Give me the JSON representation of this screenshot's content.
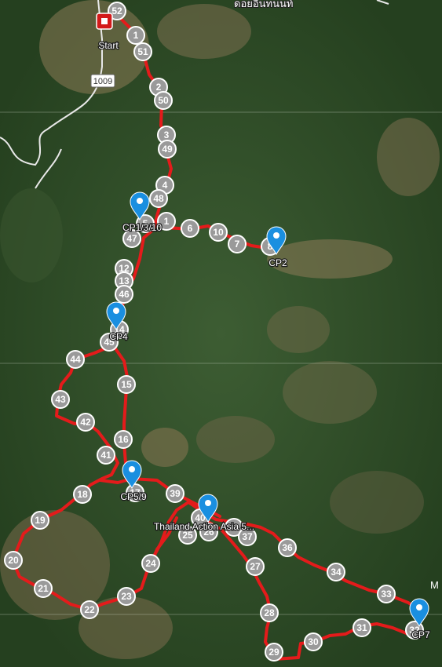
{
  "map": {
    "route_color": "#e41b1b",
    "checkpoint_color": "#1a8fe0",
    "km_marker_color": "#9a9a9a",
    "start_color": "#d31a1a",
    "start_label": "Start",
    "road_number": "1009",
    "place_name": "ดอยอินทนนท์",
    "edge_label": "M"
  },
  "checkpoints": [
    {
      "label": "CP1/3/10"
    },
    {
      "label": "CP2"
    },
    {
      "label": "CP4"
    },
    {
      "label": "CP5/9"
    },
    {
      "label": "Thailand Action Asia 5..."
    },
    {
      "label": "CP7"
    }
  ],
  "km_markers": [
    "52",
    "1",
    "51",
    "2",
    "50",
    "3",
    "49",
    "4",
    "48",
    "5",
    "1",
    "6",
    "10",
    "7",
    "8",
    "47",
    "12",
    "13",
    "46",
    "14",
    "45",
    "44",
    "15",
    "43",
    "42",
    "16",
    "41",
    "17",
    "18",
    "39",
    "40",
    "19",
    "38",
    "25",
    "26",
    "37",
    "20",
    "24",
    "36",
    "27",
    "34",
    "21",
    "23",
    "33",
    "22",
    "28",
    "31",
    "32",
    "30",
    "29"
  ]
}
